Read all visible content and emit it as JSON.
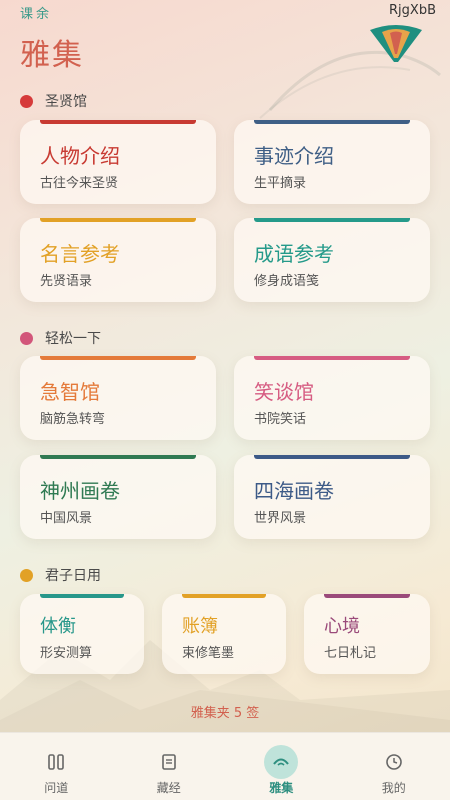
{
  "header": {
    "brand": "课余",
    "watermark": "RjgXbB",
    "title": "雅集"
  },
  "sections": [
    {
      "label": "圣贤馆",
      "color": "#d63a3a",
      "cards": [
        {
          "title": "人物介绍",
          "subtitle": "古往今来圣贤",
          "color": "#c83a32"
        },
        {
          "title": "事迹介绍",
          "subtitle": "生平摘录",
          "color": "#3f5f86"
        },
        {
          "title": "名言参考",
          "subtitle": "先贤语录",
          "color": "#e2a126"
        },
        {
          "title": "成语参考",
          "subtitle": "修身成语笺",
          "color": "#259a8a"
        }
      ]
    },
    {
      "label": "轻松一下",
      "color": "#d2567a",
      "cards": [
        {
          "title": "急智馆",
          "subtitle": "脑筋急转弯",
          "color": "#e47a3a"
        },
        {
          "title": "笑谈馆",
          "subtitle": "书院笑话",
          "color": "#d65c82"
        },
        {
          "title": "神州画卷",
          "subtitle": "中国风景",
          "color": "#2f7a52"
        },
        {
          "title": "四海画卷",
          "subtitle": "世界风景",
          "color": "#3c5a87"
        }
      ]
    },
    {
      "label": "君子日用",
      "color": "#e2a126",
      "cards": [
        {
          "title": "体衡",
          "subtitle": "形安测算",
          "color": "#27978a"
        },
        {
          "title": "账簿",
          "subtitle": "束修笔墨",
          "color": "#e2a126"
        },
        {
          "title": "心境",
          "subtitle": "七日札记",
          "color": "#9a4a7a"
        }
      ]
    }
  ],
  "footer_note": "雅集夹 5 签",
  "tabs": [
    {
      "label": "问道",
      "icon": "columns-icon",
      "active": false
    },
    {
      "label": "藏经",
      "icon": "book-icon",
      "active": false
    },
    {
      "label": "雅集",
      "icon": "arc-icon",
      "active": true
    },
    {
      "label": "我的",
      "icon": "clock-icon",
      "active": false
    }
  ]
}
